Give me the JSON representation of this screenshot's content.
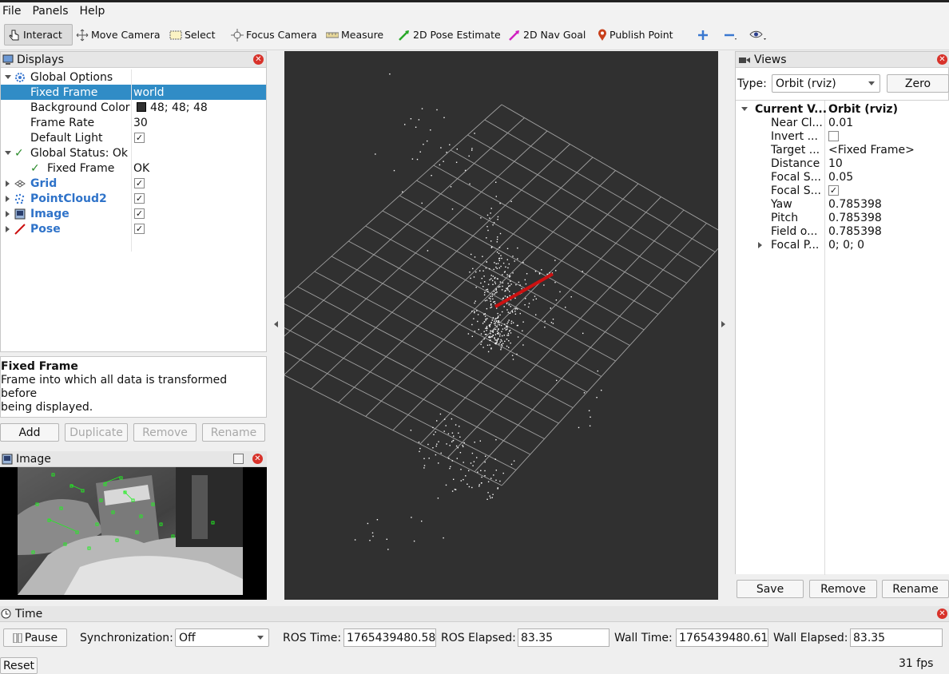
{
  "menu": [
    "File",
    "Panels",
    "Help"
  ],
  "toolbar": {
    "interact": "Interact",
    "move_camera": "Move Camera",
    "select": "Select",
    "focus_camera": "Focus Camera",
    "measure": "Measure",
    "pose_estimate": "2D Pose Estimate",
    "nav_goal": "2D Nav Goal",
    "publish_point": "Publish Point"
  },
  "displays": {
    "title": "Displays",
    "global_options": "Global Options",
    "fixed_frame_label": "Fixed Frame",
    "fixed_frame_value": "world",
    "background_color_label": "Background Color",
    "background_color_value": "48; 48; 48",
    "background_color_hex": "#303030",
    "frame_rate_label": "Frame Rate",
    "frame_rate_value": "30",
    "default_light_label": "Default Light",
    "global_status": "Global Status: Ok",
    "status_fixed_frame_label": "Fixed Frame",
    "status_fixed_frame_value": "OK",
    "items": [
      {
        "name": "Grid",
        "icon": "grid-icon",
        "checked": true
      },
      {
        "name": "PointCloud2",
        "icon": "pointcloud-icon",
        "checked": true
      },
      {
        "name": "Image",
        "icon": "image-icon",
        "checked": true
      },
      {
        "name": "Pose",
        "icon": "pose-arrow-icon",
        "checked": true
      }
    ],
    "help_title": "Fixed Frame",
    "help_text_1": "Frame into which all data is transformed before",
    "help_text_2": "being displayed.",
    "buttons": {
      "add": "Add",
      "duplicate": "Duplicate",
      "remove": "Remove",
      "rename": "Rename"
    }
  },
  "image_panel": {
    "title": "Image"
  },
  "views": {
    "title": "Views",
    "type_label": "Type:",
    "type_value": "Orbit (rviz)",
    "zero": "Zero",
    "current_view_label": "Current V...",
    "current_view_value": "Orbit (rviz)",
    "props": [
      {
        "label": "Near Cl...",
        "value": "0.01"
      },
      {
        "label": "Invert ...",
        "value": ""
      },
      {
        "label": "Target ...",
        "value": "<Fixed Frame>"
      },
      {
        "label": "Distance",
        "value": "10"
      },
      {
        "label": "Focal S...",
        "value": "0.05"
      },
      {
        "label": "Focal S...",
        "value": ""
      },
      {
        "label": "Yaw",
        "value": "0.785398"
      },
      {
        "label": "Pitch",
        "value": "0.785398"
      },
      {
        "label": "Field o...",
        "value": "0.785398"
      },
      {
        "label": "Focal P...",
        "value": "0; 0; 0"
      }
    ],
    "buttons": {
      "save": "Save",
      "remove": "Remove",
      "rename": "Rename"
    }
  },
  "time": {
    "title": "Time",
    "pause": "Pause",
    "sync_label": "Synchronization:",
    "sync_value": "Off",
    "ros_time_label": "ROS Time:",
    "ros_time": "1765439480.58",
    "ros_elapsed_label": "ROS Elapsed:",
    "ros_elapsed": "83.35",
    "wall_time_label": "Wall Time:",
    "wall_time": "1765439480.61",
    "wall_elapsed_label": "Wall Elapsed:",
    "wall_elapsed": "83.35",
    "reset": "Reset",
    "fps": "31 fps"
  },
  "colors": {
    "viewport_bg": "#303030",
    "selection": "#308cc6",
    "pose_arrow": "#cc1111",
    "accent_blue": "#2f73c9"
  }
}
